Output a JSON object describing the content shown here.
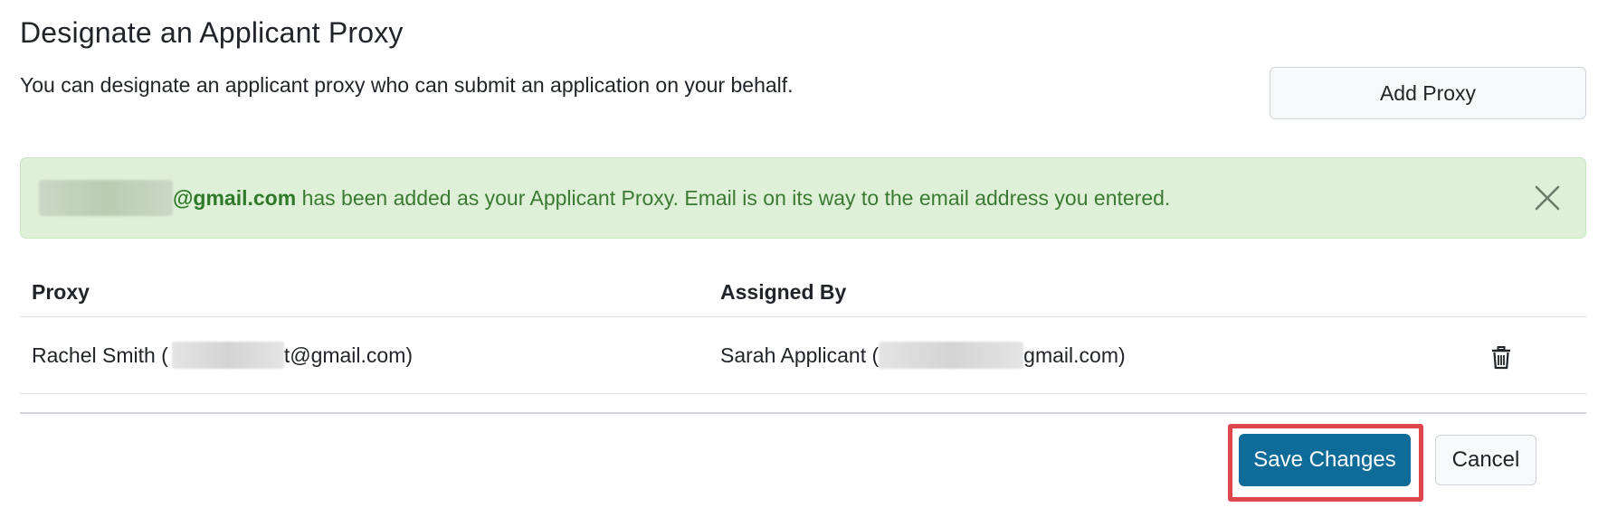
{
  "header": {
    "title": "Designate an Applicant Proxy",
    "description": "You can designate an applicant proxy who can submit an application on your behalf.",
    "add_proxy_label": "Add Proxy"
  },
  "alert": {
    "email_visible": "@gmail.com",
    "message": " has been added as your Applicant Proxy. Email is on its way to the email address you entered.",
    "close_icon": "close-icon",
    "color": "#dff0d8",
    "text_color": "#3b7a33"
  },
  "table": {
    "columns": [
      "Proxy",
      "Assigned By"
    ],
    "rows": [
      {
        "proxy_name_prefix": "Rachel Smith (",
        "proxy_email_suffix": "t@gmail.com)",
        "assigned_prefix": "Sarah Applicant (",
        "assigned_email_suffix": "gmail.com)",
        "action_icon": "trash-icon"
      }
    ]
  },
  "footer": {
    "save_label": "Save Changes",
    "cancel_label": "Cancel",
    "save_color": "#0f6b98",
    "highlight_color": "#e0474c"
  }
}
